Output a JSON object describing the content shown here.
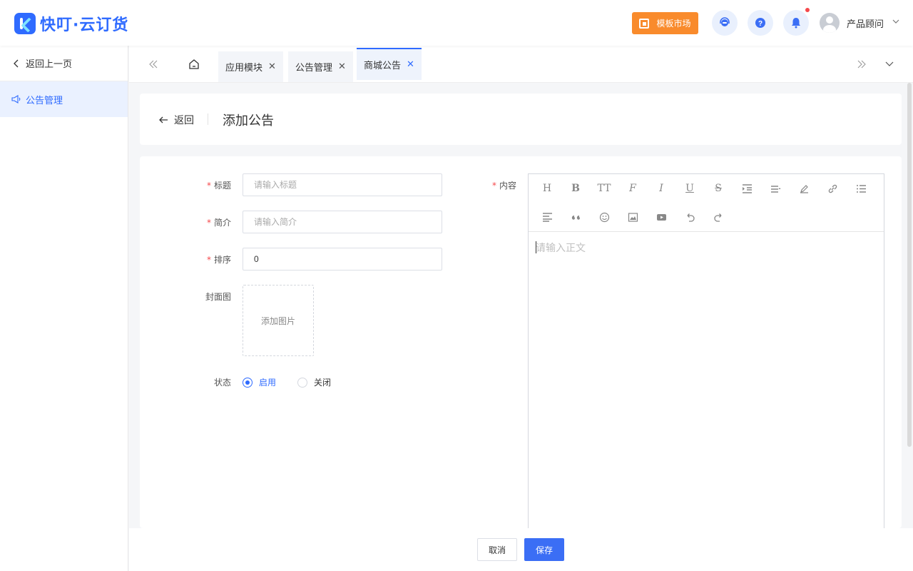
{
  "header": {
    "logo_text": "快叮·云订货",
    "market_button": "模板市场",
    "user_name": "产品顾问",
    "icons": [
      "service-icon",
      "help-icon",
      "bell-icon"
    ]
  },
  "sidebar": {
    "back_label": "返回上一页",
    "items": [
      {
        "label": "公告管理",
        "active": true
      }
    ]
  },
  "tabs": [
    {
      "label": "应用模块",
      "active": false
    },
    {
      "label": "公告管理",
      "active": false
    },
    {
      "label": "商城公告",
      "active": true
    }
  ],
  "page": {
    "back_label": "返回",
    "title": "添加公告"
  },
  "form": {
    "title_label": "标题",
    "title_placeholder": "请输入标题",
    "intro_label": "简介",
    "intro_placeholder": "请输入简介",
    "sort_label": "排序",
    "sort_value": "0",
    "cover_label": "封面图",
    "cover_upload": "添加图片",
    "status_label": "状态",
    "status_on": "启用",
    "status_off": "关闭",
    "status_selected": "启用",
    "content_label": "内容",
    "content_placeholder": "请输入正文",
    "required_mark": "*"
  },
  "toolbar": {
    "row1": [
      "H",
      "B",
      "TT",
      "F",
      "I",
      "U",
      "S"
    ]
  },
  "footer": {
    "cancel": "取消",
    "save": "保存"
  },
  "colors": {
    "primary": "#2f6bff",
    "market_orange": "#f98b2c",
    "required_red": "#f5484b"
  }
}
